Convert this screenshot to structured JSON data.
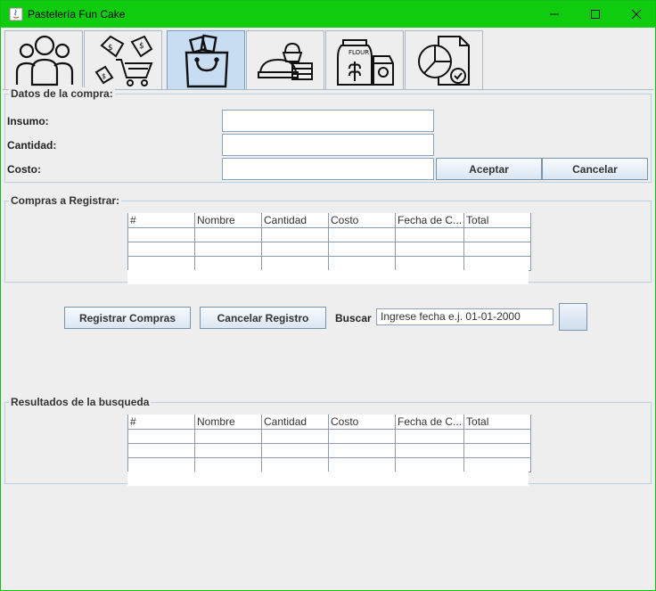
{
  "window": {
    "title": "Pastelería Fun Cake",
    "minimize_label": "—",
    "maximize_label": "☐",
    "close_label": "✕"
  },
  "tabs": [
    {
      "icon": "customers-icon",
      "selected": false
    },
    {
      "icon": "sales-cart-icon",
      "selected": false
    },
    {
      "icon": "shopping-bag-icon",
      "selected": true
    },
    {
      "icon": "bakery-products-icon",
      "selected": false
    },
    {
      "icon": "supplies-icon",
      "selected": false
    },
    {
      "icon": "report-chart-icon",
      "selected": false
    }
  ],
  "datos": {
    "title": "Datos de la compra:",
    "insumo_label": "Insumo:",
    "insumo_value": "",
    "cantidad_label": "Cantidad:",
    "cantidad_value": "",
    "costo_label": "Costo:",
    "costo_value": "",
    "aceptar_label": "Aceptar",
    "cancelar_label": "Cancelar"
  },
  "compras": {
    "title": "Compras a Registrar:",
    "columns": [
      "#",
      "Nombre",
      "Cantidad",
      "Costo",
      "Fecha de C...",
      "Total"
    ]
  },
  "actions": {
    "registrar_label": "Registrar Compras",
    "cancelar_registro_label": "Cancelar Registro",
    "buscar_label": "Buscar",
    "buscar_value": "Ingrese fecha e.j. 01-01-2000"
  },
  "resultados": {
    "title": "Resultados de la busqueda",
    "columns": [
      "#",
      "Nombre",
      "Cantidad",
      "Costo",
      "Fecha de C...",
      "Total"
    ]
  },
  "colors": {
    "titlebar": "#0fcc0f",
    "selected_tab": "#c8dcf2"
  }
}
